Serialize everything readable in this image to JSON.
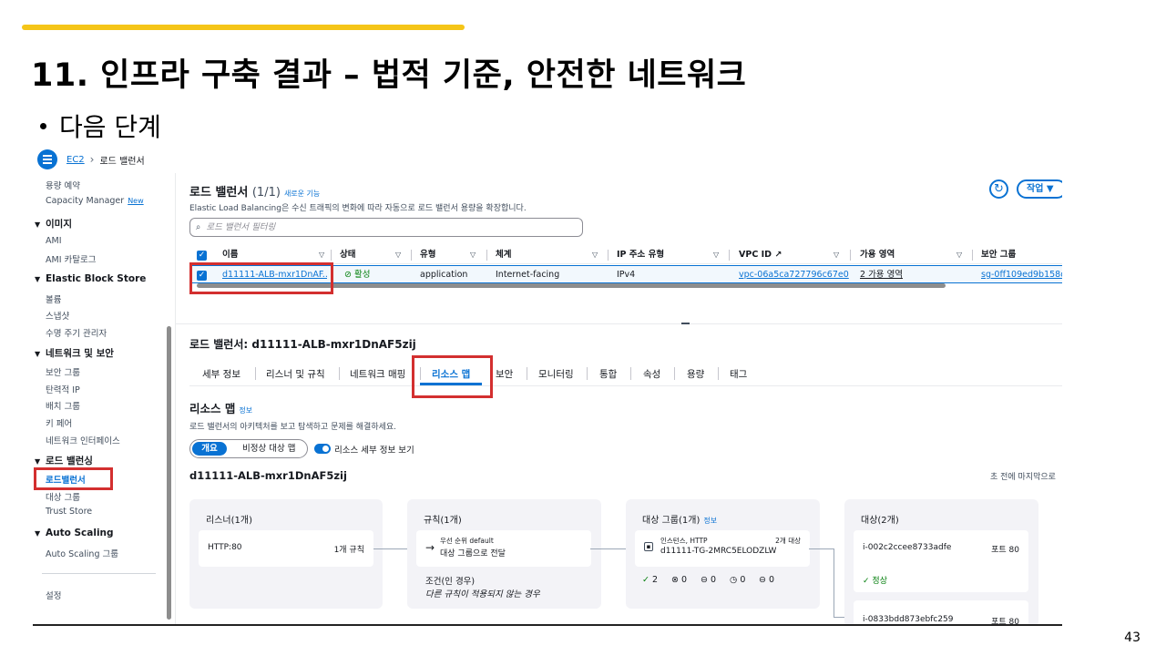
{
  "slide": {
    "title": "11. 인프라 구축 결과 – 법적 기준, 안전한 네트워크",
    "bullet": "다음 단계",
    "page_number": "43",
    "accent_color": "#f5c518"
  },
  "breadcrumb": {
    "root": "EC2",
    "current": "로드 밸런서"
  },
  "sidebar": {
    "items_top": [
      "용량 예약",
      "Capacity Manager"
    ],
    "new_badge": "New",
    "sections": [
      {
        "title": "이미지",
        "items": [
          "AMI",
          "AMI 카탈로그"
        ]
      },
      {
        "title": "Elastic Block Store",
        "items": [
          "볼륨",
          "스냅샷",
          "수명 주기 관리자"
        ]
      },
      {
        "title": "네트워크 및 보안",
        "items": [
          "보안 그룹",
          "탄력적 IP",
          "배치 그룹",
          "키 페어",
          "네트워크 인터페이스"
        ]
      },
      {
        "title": "로드 밸런싱",
        "items": [
          "로드밸런서",
          "대상 그룹",
          "Trust Store"
        ]
      },
      {
        "title": "Auto Scaling",
        "items": [
          "Auto Scaling 그룹"
        ]
      }
    ],
    "settings": "설정"
  },
  "list": {
    "title": "로드 밸런서",
    "count": "(1/1)",
    "new_features": "새로운 기능",
    "description": "Elastic Load Balancing은 수신 트래픽의 변화에 따라 자동으로 로드 밸런서 용량을 확장합니다.",
    "search_placeholder": "로드 밸런서 필터링",
    "actions_label": "작업",
    "columns": [
      "이름",
      "상태",
      "유형",
      "체계",
      "IP 주소 유형",
      "VPC ID",
      "가용 영역",
      "보안 그룹"
    ],
    "row": {
      "name": "d11111-ALB-mxr1DnAF...",
      "status": "활성",
      "type": "application",
      "scheme": "Internet-facing",
      "ip_type": "IPv4",
      "vpc": "vpc-06a5ca727796c67e0",
      "az": "2 가용 영역",
      "sg": "sg-0ff109ed9b158d"
    }
  },
  "detail": {
    "title": "로드 밸런서: d11111-ALB-mxr1DnAF5zij",
    "tabs": [
      "세부 정보",
      "리스너 및 규칙",
      "네트워크 매핑",
      "리소스 맵",
      "보안",
      "모니터링",
      "통합",
      "속성",
      "용량",
      "태그"
    ],
    "active_tab": "리소스 맵",
    "resource_map": {
      "title": "리소스 맵",
      "info": "정보",
      "description": "로드 밸런서의 아키텍처를 보고 탐색하고 문제를 해결하세요.",
      "seg_overview": "개요",
      "seg_unhealthy": "비정상 대상 맵",
      "toggle_label": "리소스 세부 정보 보기",
      "lb_name": "d11111-ALB-mxr1DnAF5zij",
      "last_updated": "초 전에 마지막으로",
      "listeners": {
        "title": "리스너(1개)",
        "name": "HTTP:80",
        "rules": "1개 규칙"
      },
      "rules": {
        "title": "규칙(1개)",
        "priority": "우선 순위 default",
        "action": "대상 그룹으로 전달",
        "cond_label": "조건(인 경우)",
        "cond_text": "다른 규칙이 적용되지 않는 경우"
      },
      "target_groups": {
        "title": "대상 그룹(1개)",
        "info": "정보",
        "kind": "인스턴스, HTTP",
        "count": "2개 대상",
        "name": "d11111-TG-2MRC5ELODZLW",
        "healthy": "2",
        "unhealthy": "0",
        "unused": "0",
        "draining": "0",
        "unavailable": "0"
      },
      "targets": {
        "title": "대상(2개)",
        "items": [
          {
            "id": "i-002c2ccee8733adfe",
            "port": "포트 80",
            "health": "정상"
          },
          {
            "id": "i-0833bdd873ebfc259",
            "port": "포트 80"
          }
        ]
      }
    }
  }
}
